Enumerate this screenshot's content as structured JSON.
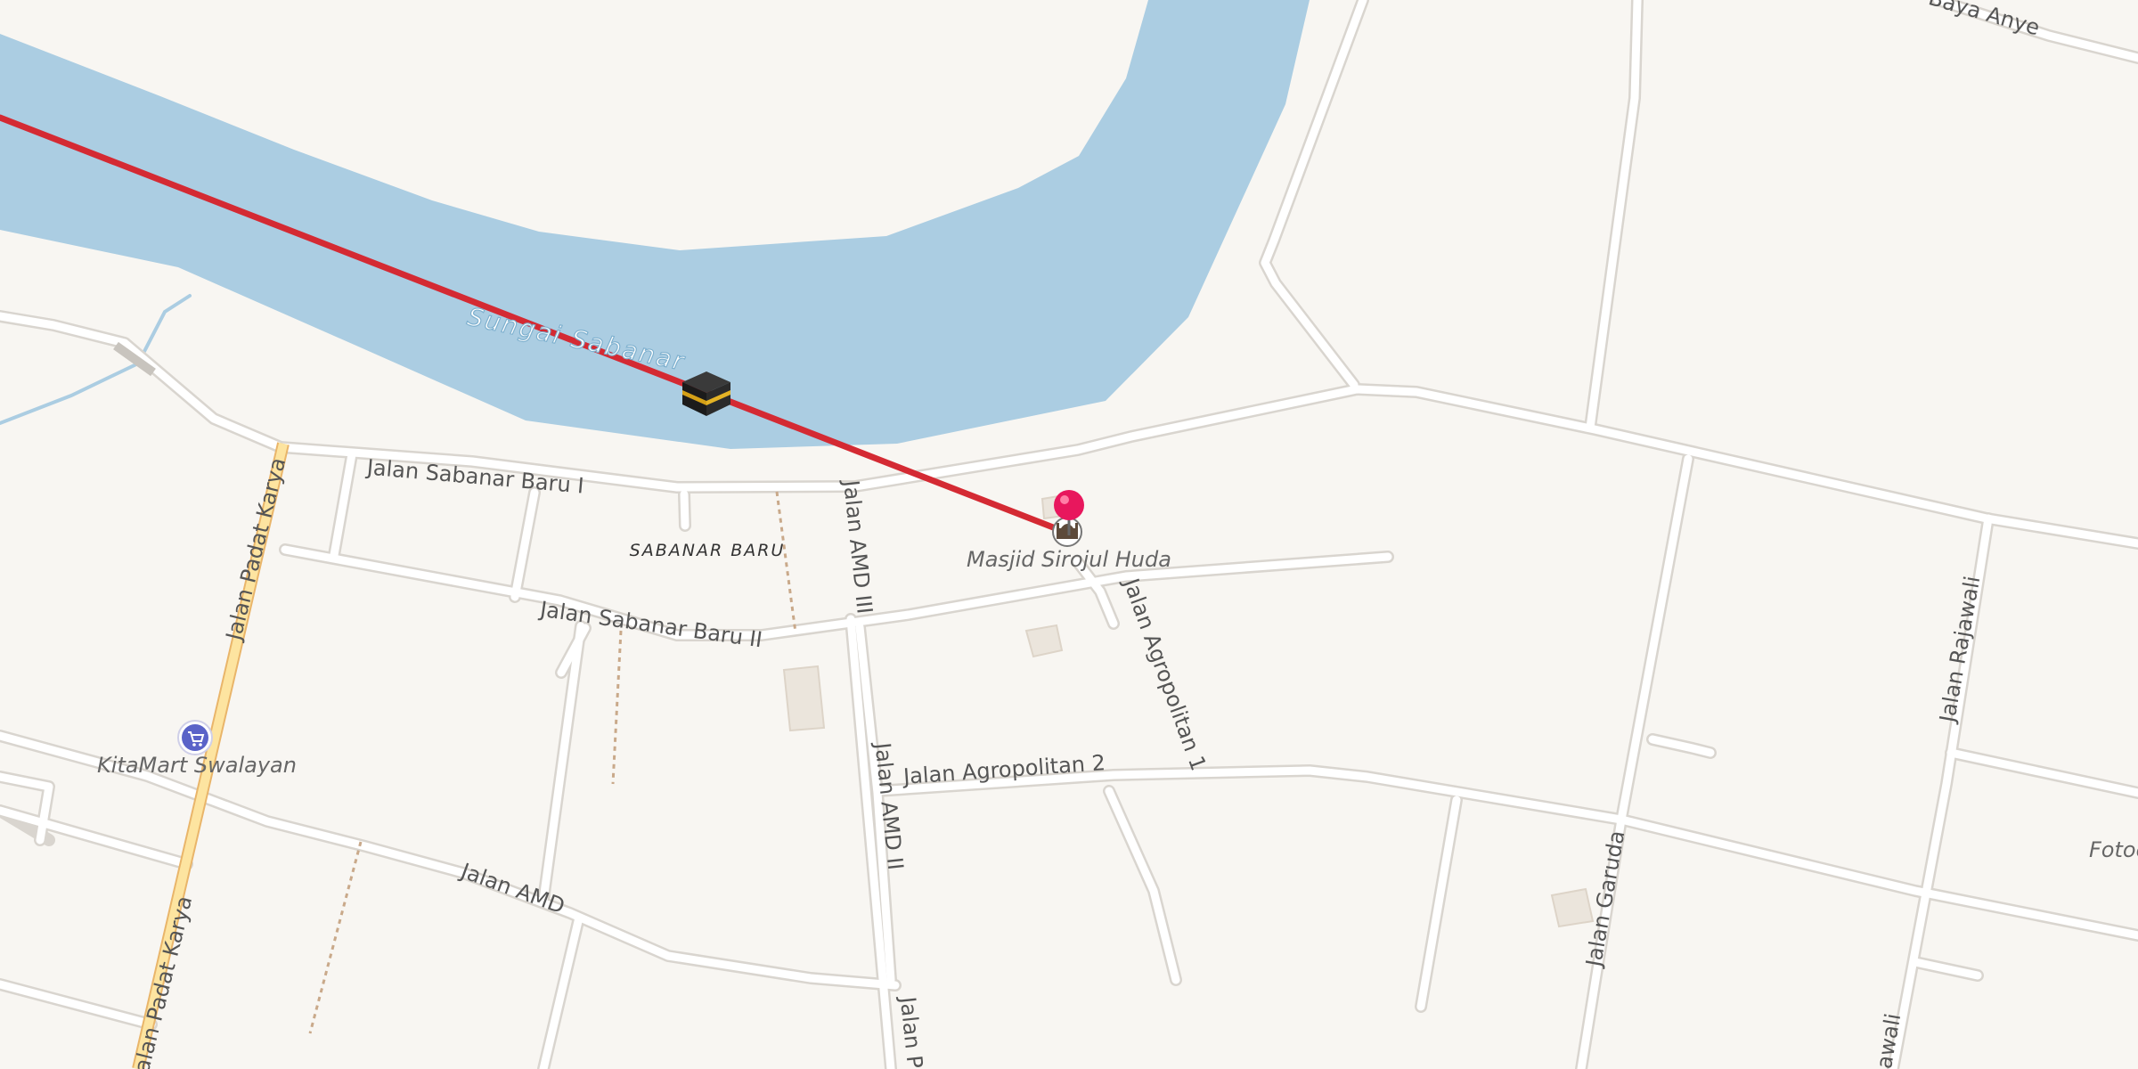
{
  "map": {
    "labels": {
      "river": "Sungai Sabanar",
      "road_sabanar_baru_1": "Jalan Sabanar Baru I",
      "road_sabanar_baru_2": "Jalan Sabanar Baru II",
      "road_padat_karya_top": "Jalan Padat Karya",
      "road_padat_karya_bottom": "Jalan Padat Karya",
      "road_amd_iii": "Jalan AMD III",
      "road_amd_ii": "Jalan AMD II",
      "road_amd_ii_cut": "Jalan P",
      "road_amd": "Jalan AMD",
      "road_agropolitan_1": "Jalan Agropolitan 1",
      "road_agropolitan_2": "Jalan Agropolitan 2",
      "road_garuda": "Jalan Garuda",
      "road_rajawali": "Jalan Rajawali",
      "road_rajawali_cut": "awali",
      "road_top_right": "Baya Anye",
      "area": "SABANAR BARU",
      "poi_mosque": "Masjid Sirojul Huda",
      "poi_kitamart": "KitaMart Swalayan",
      "poi_fotoc": "Fotoc"
    },
    "colors": {
      "land": "#f8f6f2",
      "water": "#abcde2",
      "road": "#ffffff",
      "road_casing": "#d9d5cf",
      "primary_road": "#fde4a0",
      "primary_casing": "#e9b56a",
      "route_line": "#d42a33",
      "pin": "#e8175d",
      "poi_shop": "#5a63c8",
      "label_text": "#555555"
    },
    "icons": {
      "kaaba": "kaaba-icon",
      "pin": "map-pin-icon",
      "mosque": "mosque-icon",
      "shop": "shopping-cart-icon"
    }
  }
}
